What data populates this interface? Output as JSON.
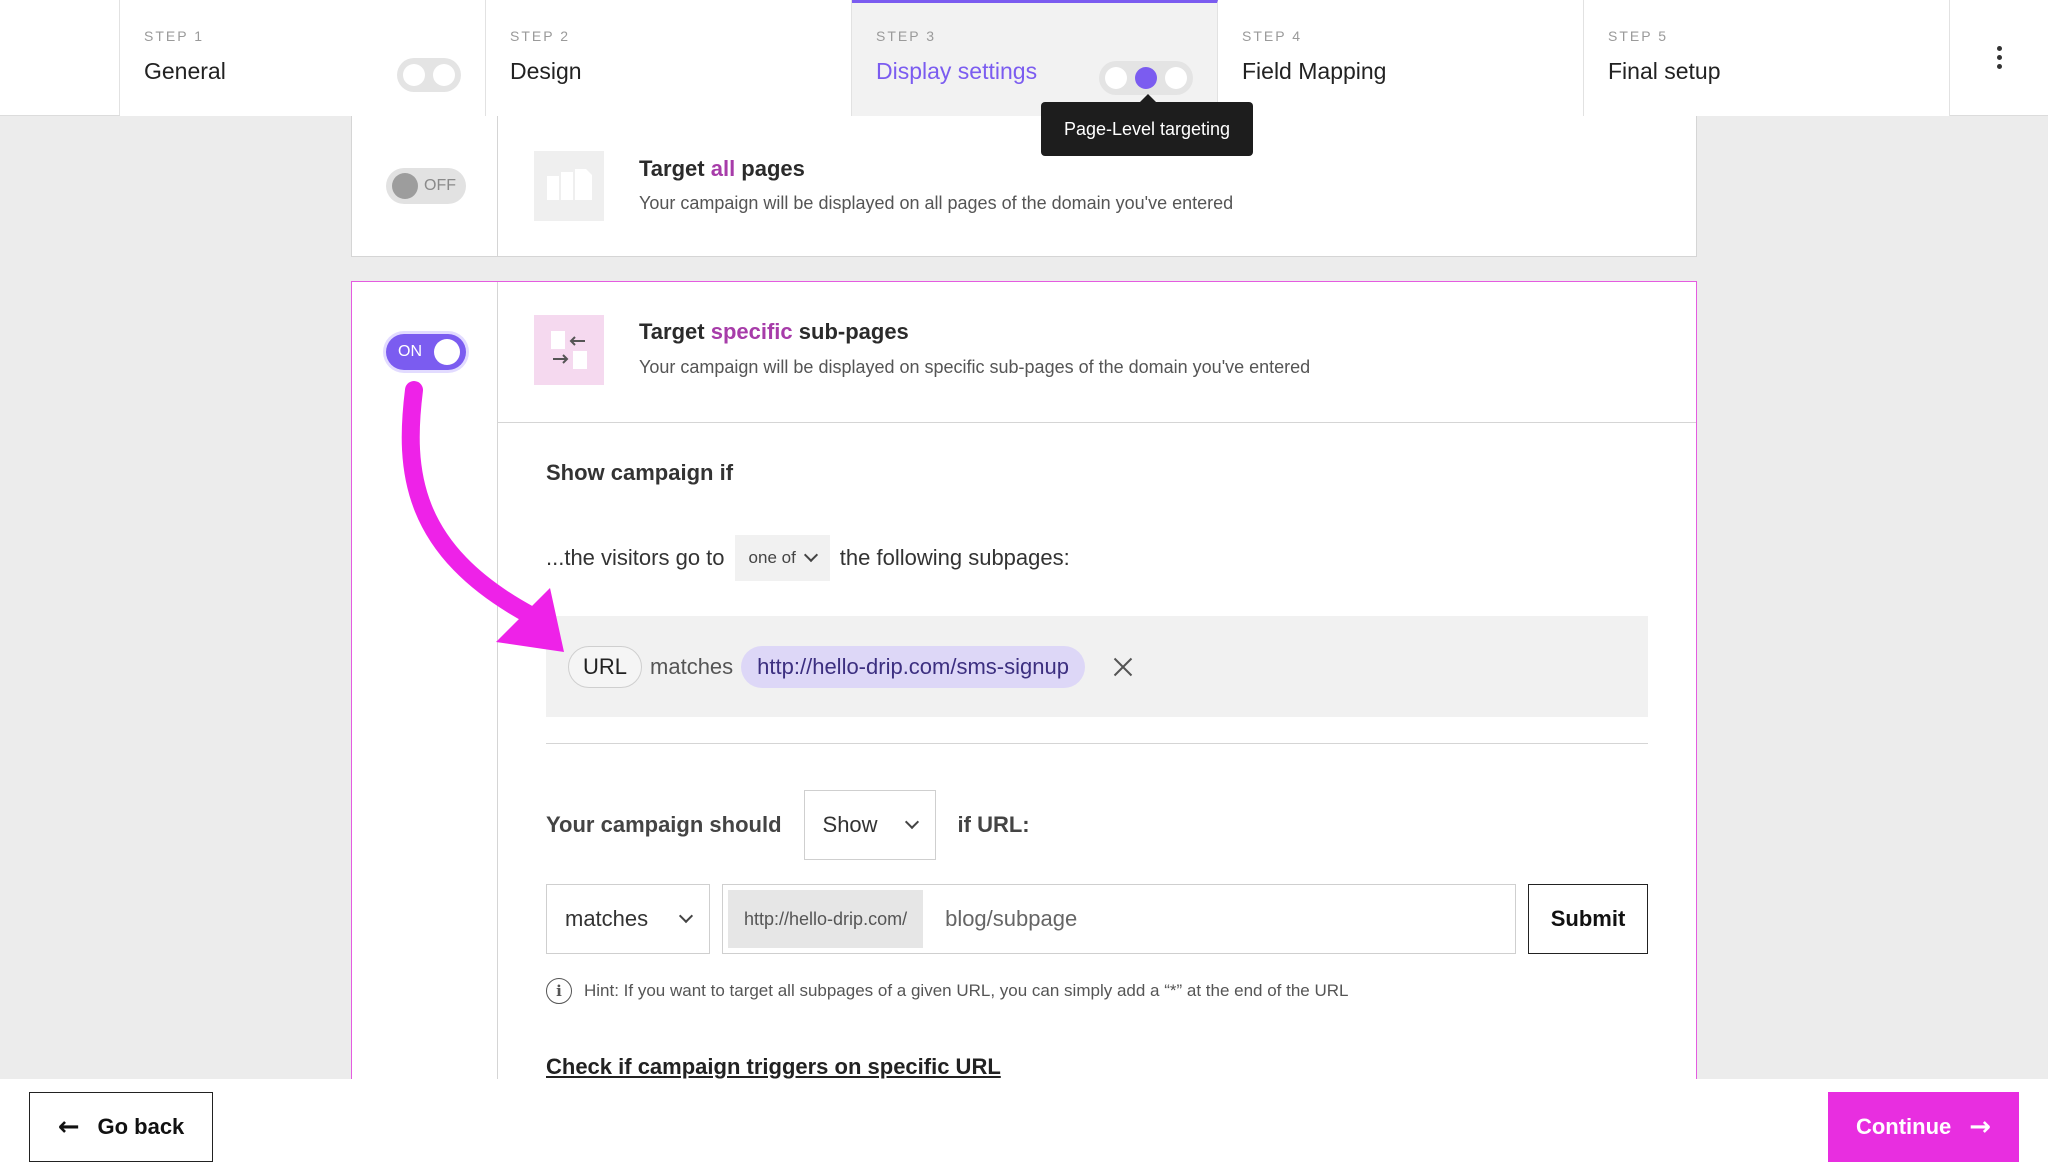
{
  "steps": [
    {
      "num": "STEP 1",
      "title": "General"
    },
    {
      "num": "STEP 2",
      "title": "Design"
    },
    {
      "num": "STEP 3",
      "title": "Display settings"
    },
    {
      "num": "STEP 4",
      "title": "Field Mapping"
    },
    {
      "num": "STEP 5",
      "title": "Final setup"
    }
  ],
  "active_step": 3,
  "tooltip": "Page-Level targeting",
  "target_all": {
    "toggle_label": "OFF",
    "title_pre": "Target ",
    "title_hl": "all",
    "title_post": " pages",
    "subtitle": "Your campaign will be displayed on all pages of the domain you've entered"
  },
  "target_specific": {
    "toggle_label": "ON",
    "title_pre": "Target ",
    "title_hl": "specific",
    "title_post": " sub-pages",
    "subtitle": "Your campaign will be displayed on specific sub-pages of the domain you've entered"
  },
  "rules": {
    "heading": "Show campaign if",
    "visitors_prefix": "...the visitors go to",
    "visitors_select": "one of",
    "visitors_suffix": "the following subpages:",
    "rule_field": "URL",
    "rule_operator": "matches",
    "rule_value": "http://hello-drip.com/sms-signup"
  },
  "form": {
    "should_label": "Your campaign should",
    "show_select": "Show",
    "if_url_label": "if URL:",
    "match_select": "matches",
    "url_prefix": "http://hello-drip.com/",
    "url_placeholder": "blog/subpage",
    "submit_label": "Submit",
    "hint": "Hint: If you want to target all subpages of a given URL, you can simply add a “*” at the end of the URL",
    "check_link": "Check if campaign triggers on specific URL"
  },
  "footer": {
    "back_label": "Go back",
    "continue_label": "Continue"
  },
  "colors": {
    "accent_purple": "#7b5cf0",
    "accent_magenta": "#e82ee0",
    "highlight_text": "#a73ca9"
  }
}
